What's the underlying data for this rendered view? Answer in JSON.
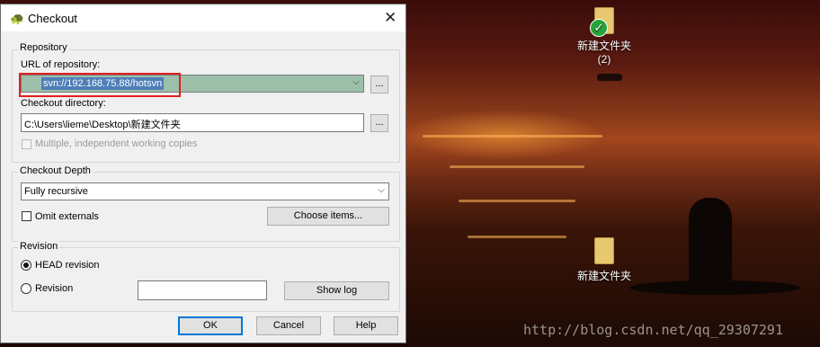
{
  "dialog": {
    "title": "Checkout",
    "close_glyph": "✕"
  },
  "repository": {
    "group_label": "Repository",
    "url_label": "URL of repository:",
    "url_value": "svn://192.168.75.88/hotsvn",
    "checkout_dir_label": "Checkout directory:",
    "checkout_dir_value": "C:\\Users\\lieme\\Desktop\\新建文件夹",
    "browse_label": "...",
    "multiple_label": "Multiple, independent working copies"
  },
  "depth": {
    "group_label": "Checkout Depth",
    "selected": "Fully recursive",
    "omit_externals_label": "Omit externals",
    "choose_items_label": "Choose items..."
  },
  "revision": {
    "group_label": "Revision",
    "head_label": "HEAD revision",
    "revision_label": "Revision",
    "revision_value": "",
    "show_log_label": "Show log"
  },
  "buttons": {
    "ok": "OK",
    "cancel": "Cancel",
    "help": "Help"
  },
  "desktop": {
    "icon1_label": "新建文件夹",
    "icon1_sub": "(2)",
    "icon2_label": "新建文件夹",
    "watermark": "http://blog.csdn.net/qq_29307291"
  }
}
